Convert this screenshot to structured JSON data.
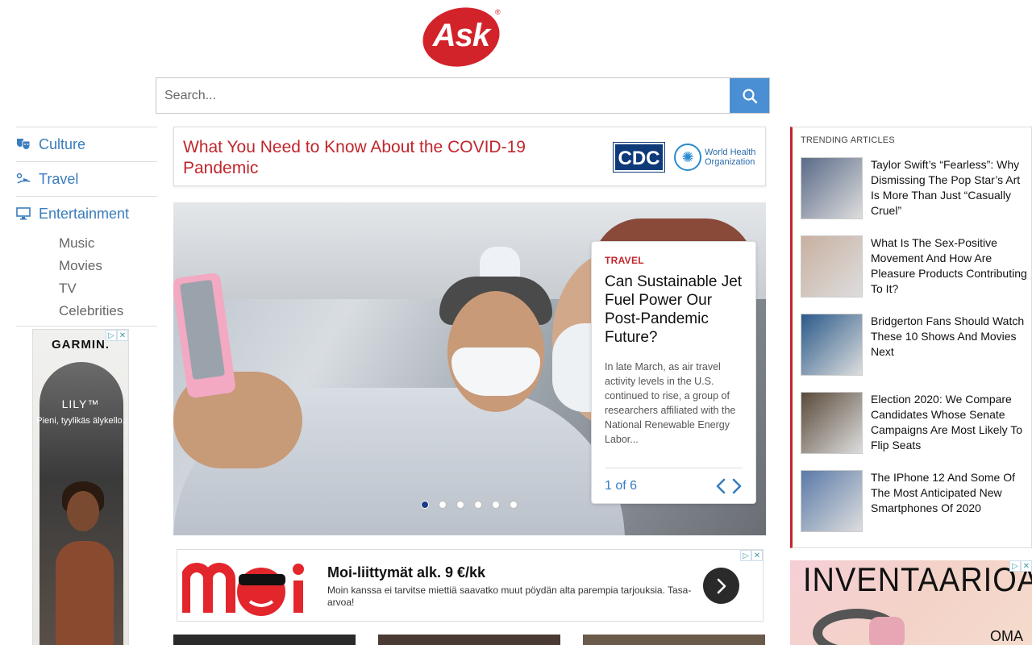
{
  "logo": {
    "text": "Ask",
    "reg": "®"
  },
  "search": {
    "placeholder": "Search..."
  },
  "nav": {
    "items": [
      {
        "label": "Culture",
        "icon": "theater-masks-icon"
      },
      {
        "label": "Travel",
        "icon": "travel-icon"
      },
      {
        "label": "Entertainment",
        "icon": "monitor-icon"
      }
    ],
    "subitems": [
      "Music",
      "Movies",
      "TV",
      "Celebrities"
    ]
  },
  "leftad": {
    "brand": "GARMIN.",
    "product": "LILY™",
    "tagline": "Pieni, tyylikäs älykello."
  },
  "covid": {
    "title": "What You Need to Know About the COVID-19 Pandemic",
    "cdc": "CDC",
    "who": "World Health Organization"
  },
  "hero": {
    "category": "TRAVEL",
    "title": "Can Sustainable Jet Fuel Power Our Post-Pandemic Future?",
    "description": "In late March, as air travel activity levels in the U.S. continued to rise, a group of researchers affiliated with the National Renewable Energy Labor...",
    "counter": "1 of 6",
    "dots_total": 6,
    "dots_active": 1
  },
  "moiad": {
    "title": "Moi-liittymät alk. 9 €/kk",
    "description": "Moin kanssa ei tarvitse miettiä saavatko muut pöydän alta parempia tarjouksia. Tasa-arvoa!"
  },
  "trending": {
    "heading": "TRENDING ARTICLES",
    "items": [
      {
        "title": "Taylor Swift’s “Fearless”: Why Dismissing The Pop Star’s Art Is More Than Just “Casually Cruel”",
        "thumb_color": "#5a6a88"
      },
      {
        "title": "What Is The Sex-Positive Movement And How Are Pleasure Products Contributing To It?",
        "thumb_color": "#c8b0a0"
      },
      {
        "title": "Bridgerton Fans Should Watch These 10 Shows And Movies Next",
        "thumb_color": "#2a5a8a"
      },
      {
        "title": "Election 2020: We Compare Candidates Whose Senate Campaigns Are Most Likely To Flip Seats",
        "thumb_color": "#5a4a3a"
      },
      {
        "title": "The IPhone 12 And Some Of The Most Anticipated New Smartphones Of 2020",
        "thumb_color": "#5a7aa8"
      }
    ]
  },
  "rightad": {
    "title": "INVENTAARIOALE",
    "sub": "OMA"
  },
  "colors": {
    "accent": "#d2232a",
    "link": "#3a7dbd",
    "search_button": "#4a8fd3"
  }
}
